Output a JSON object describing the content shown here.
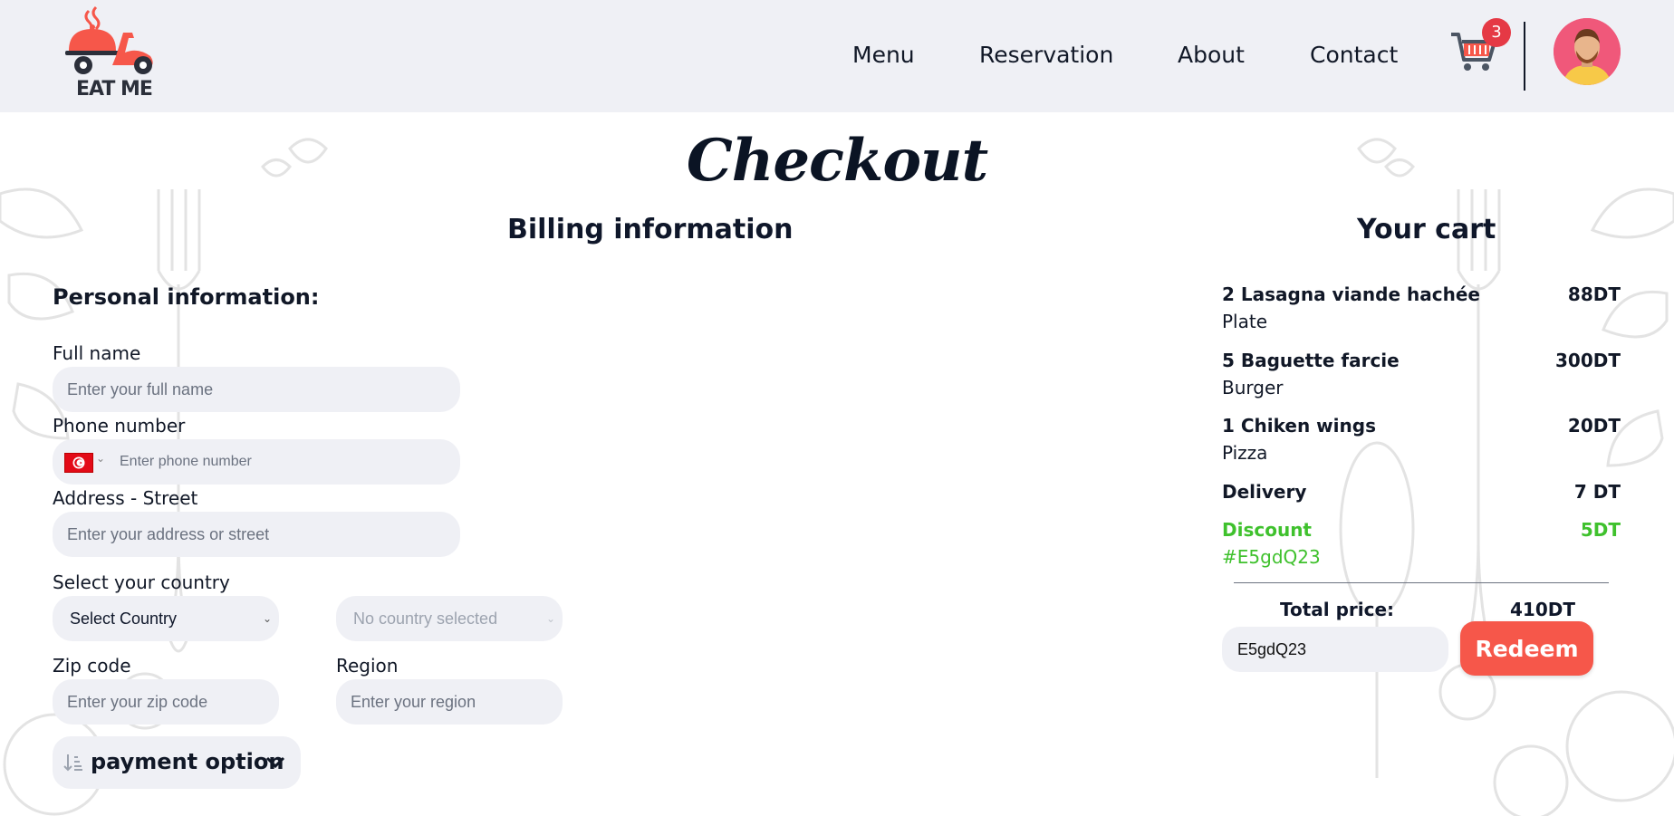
{
  "brand": {
    "name": "EAT ME",
    "accent": "#f6574a"
  },
  "nav": {
    "links": [
      {
        "label": "Menu"
      },
      {
        "label": "Reservation"
      },
      {
        "label": "About"
      },
      {
        "label": "Contact"
      }
    ],
    "cart_count": "3"
  },
  "page": {
    "title": "Checkout",
    "billing_title": "Billing information",
    "cart_title": "Your cart"
  },
  "form": {
    "personal_heading": "Personal information:",
    "full_name": {
      "label": "Full name",
      "placeholder": "Enter your full name",
      "value": ""
    },
    "phone": {
      "label": "Phone number",
      "placeholder": "Enter phone number",
      "value": "",
      "country_flag": "tunisia-flag-icon"
    },
    "address": {
      "label": "Address - Street",
      "placeholder": "Enter your address or street",
      "value": ""
    },
    "country": {
      "label": "Select your country",
      "selected": "Select Country",
      "secondary": "No country selected"
    },
    "zip": {
      "label": "Zip code",
      "placeholder": "Enter your zip code",
      "value": ""
    },
    "region": {
      "label": "Region",
      "placeholder": "Enter your region",
      "value": ""
    },
    "payment_option": "payment option"
  },
  "cart": {
    "items": [
      {
        "name": "2 Lasagna viande hachée",
        "category": "Plate",
        "price": "88DT"
      },
      {
        "name": "5 Baguette farcie",
        "category": "Burger",
        "price": "300DT"
      },
      {
        "name": "1 Chiken wings",
        "category": "Pizza",
        "price": "20DT"
      }
    ],
    "delivery": {
      "label": "Delivery",
      "price": "7 DT"
    },
    "discount": {
      "label": "Discount",
      "code": "#E5gdQ23",
      "amount": "5DT",
      "color": "#3fc12d"
    },
    "total_label": "Total price:",
    "total_value": "410DT",
    "coupon_value": "E5gdQ23",
    "redeem_label": "Redeem"
  }
}
